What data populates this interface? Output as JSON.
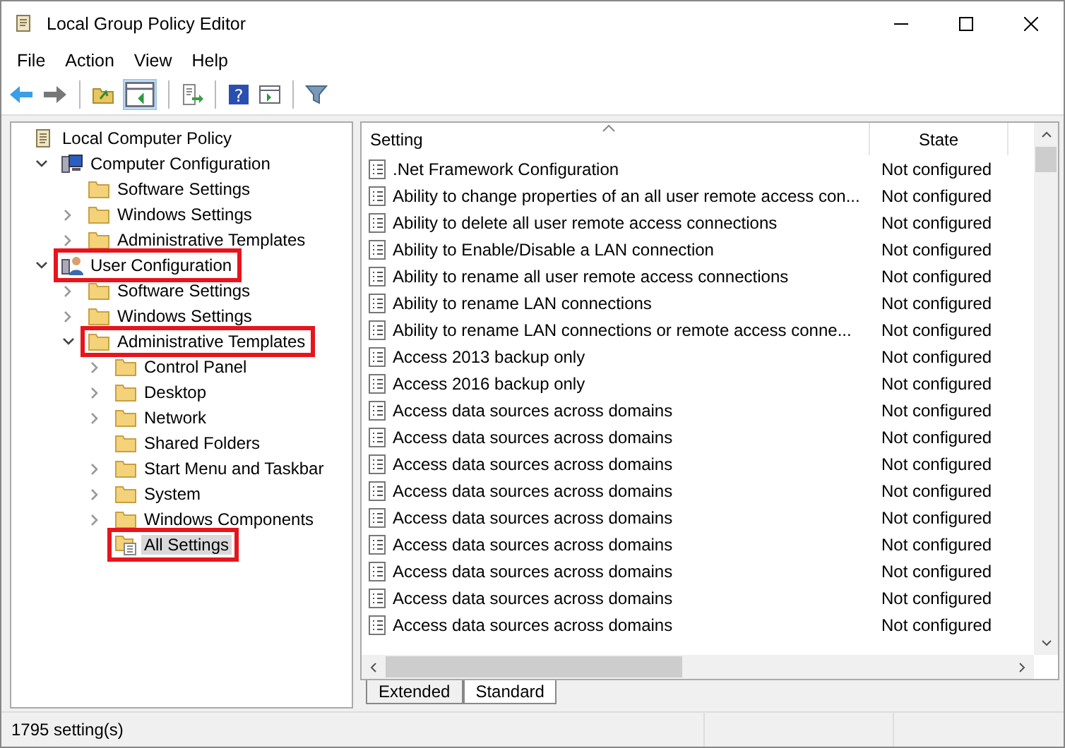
{
  "window": {
    "title": "Local Group Policy Editor"
  },
  "menu": [
    "File",
    "Action",
    "View",
    "Help"
  ],
  "toolbar": {
    "help_glyph": "?"
  },
  "tree": [
    {
      "label": "Local Computer Policy",
      "kind": "root",
      "selected": false,
      "highlighted": false,
      "children": [
        {
          "label": "Computer Configuration",
          "kind": "computer",
          "expanded": true,
          "selected": false,
          "highlighted": false,
          "children": [
            {
              "label": "Software Settings",
              "kind": "folder",
              "selected": false,
              "highlighted": false
            },
            {
              "label": "Windows Settings",
              "kind": "folder",
              "expanded": false,
              "selected": false,
              "highlighted": false
            },
            {
              "label": "Administrative Templates",
              "kind": "folder",
              "expanded": false,
              "selected": false,
              "highlighted": false
            }
          ]
        },
        {
          "label": "User Configuration",
          "kind": "user",
          "expanded": true,
          "selected": false,
          "highlighted": true,
          "children": [
            {
              "label": "Software Settings",
              "kind": "folder",
              "expanded": false,
              "selected": false,
              "highlighted": false
            },
            {
              "label": "Windows Settings",
              "kind": "folder",
              "expanded": false,
              "selected": false,
              "highlighted": false
            },
            {
              "label": "Administrative Templates",
              "kind": "folder",
              "expanded": true,
              "selected": false,
              "highlighted": true,
              "children": [
                {
                  "label": "Control Panel",
                  "kind": "folder",
                  "expanded": false,
                  "selected": false,
                  "highlighted": false
                },
                {
                  "label": "Desktop",
                  "kind": "folder",
                  "expanded": false,
                  "selected": false,
                  "highlighted": false
                },
                {
                  "label": "Network",
                  "kind": "folder",
                  "expanded": false,
                  "selected": false,
                  "highlighted": false
                },
                {
                  "label": "Shared Folders",
                  "kind": "folder",
                  "selected": false,
                  "highlighted": false
                },
                {
                  "label": "Start Menu and Taskbar",
                  "kind": "folder",
                  "expanded": false,
                  "selected": false,
                  "highlighted": false
                },
                {
                  "label": "System",
                  "kind": "folder",
                  "expanded": false,
                  "selected": false,
                  "highlighted": false
                },
                {
                  "label": "Windows Components",
                  "kind": "folder",
                  "expanded": false,
                  "selected": false,
                  "highlighted": false
                },
                {
                  "label": "All Settings",
                  "kind": "all-settings",
                  "selected": true,
                  "highlighted": true
                }
              ]
            }
          ]
        }
      ]
    }
  ],
  "table": {
    "columns": [
      "Setting",
      "State"
    ],
    "rows": [
      {
        "setting": ".Net Framework Configuration",
        "state": "Not configured"
      },
      {
        "setting": "Ability to change properties of an all user remote access con...",
        "state": "Not configured"
      },
      {
        "setting": "Ability to delete all user remote access connections",
        "state": "Not configured"
      },
      {
        "setting": "Ability to Enable/Disable a LAN connection",
        "state": "Not configured"
      },
      {
        "setting": "Ability to rename all user remote access connections",
        "state": "Not configured"
      },
      {
        "setting": "Ability to rename LAN connections",
        "state": "Not configured"
      },
      {
        "setting": "Ability to rename LAN connections or remote access conne...",
        "state": "Not configured"
      },
      {
        "setting": "Access 2013 backup only",
        "state": "Not configured"
      },
      {
        "setting": "Access 2016 backup only",
        "state": "Not configured"
      },
      {
        "setting": "Access data sources across domains",
        "state": "Not configured"
      },
      {
        "setting": "Access data sources across domains",
        "state": "Not configured"
      },
      {
        "setting": "Access data sources across domains",
        "state": "Not configured"
      },
      {
        "setting": "Access data sources across domains",
        "state": "Not configured"
      },
      {
        "setting": "Access data sources across domains",
        "state": "Not configured"
      },
      {
        "setting": "Access data sources across domains",
        "state": "Not configured"
      },
      {
        "setting": "Access data sources across domains",
        "state": "Not configured"
      },
      {
        "setting": "Access data sources across domains",
        "state": "Not configured"
      },
      {
        "setting": "Access data sources across domains",
        "state": "Not configured"
      }
    ]
  },
  "view_tabs": [
    {
      "label": "Extended",
      "selected": false
    },
    {
      "label": "Standard",
      "selected": true
    }
  ],
  "status_bar": "1795 setting(s)"
}
